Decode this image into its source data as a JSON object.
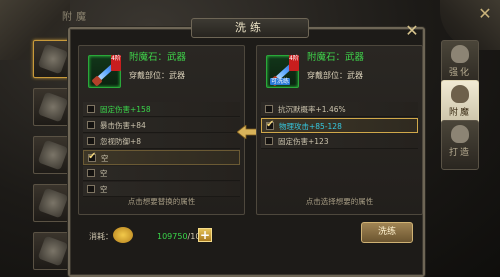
{
  "background": {
    "title": "附魔",
    "close_glyph": "✕"
  },
  "side_tabs": [
    {
      "label": "强化",
      "icon": "bag-icon",
      "active": false
    },
    {
      "label": "附魔",
      "icon": "bag-icon",
      "active": true
    },
    {
      "label": "打造",
      "icon": "bag-icon",
      "active": false
    }
  ],
  "dialog": {
    "title": "洗练",
    "close_glyph": "✕"
  },
  "left_panel": {
    "item_title": "附魔石：武器",
    "slot_label": "穿戴部位：武器",
    "level_badge": "4阶",
    "attributes": [
      {
        "text": "固定伤害+158",
        "color": "green",
        "checked": false
      },
      {
        "text": "暴击伤害+84",
        "color": "normal",
        "checked": false
      },
      {
        "text": "忽视防御+8",
        "color": "normal",
        "checked": false
      },
      {
        "text": "空",
        "color": "normal",
        "checked": true
      },
      {
        "text": "空",
        "color": "normal",
        "checked": false
      },
      {
        "text": "空",
        "color": "normal",
        "checked": false
      }
    ],
    "hint": "点击想要替换的属性"
  },
  "right_panel": {
    "item_title": "附魔石：武器",
    "slot_label": "穿戴部位：武器",
    "level_badge": "4阶",
    "wash_badge": "可洗练",
    "attributes": [
      {
        "text": "抗沉默概率+1.46%",
        "color": "normal",
        "checked": false
      },
      {
        "text": "物理攻击+85-128",
        "color": "cyan",
        "checked": true
      },
      {
        "text": "固定伤害+123",
        "color": "normal",
        "checked": false
      }
    ],
    "hint": "点击选择想要的属性"
  },
  "cost": {
    "label": "消耗：",
    "have": "109750",
    "need": "/100",
    "plus_glyph": "+"
  },
  "wash_button_label": "洗练",
  "colors": {
    "green": "#39d64a",
    "cyan": "#35c8e0",
    "gold": "#c99a3a"
  }
}
